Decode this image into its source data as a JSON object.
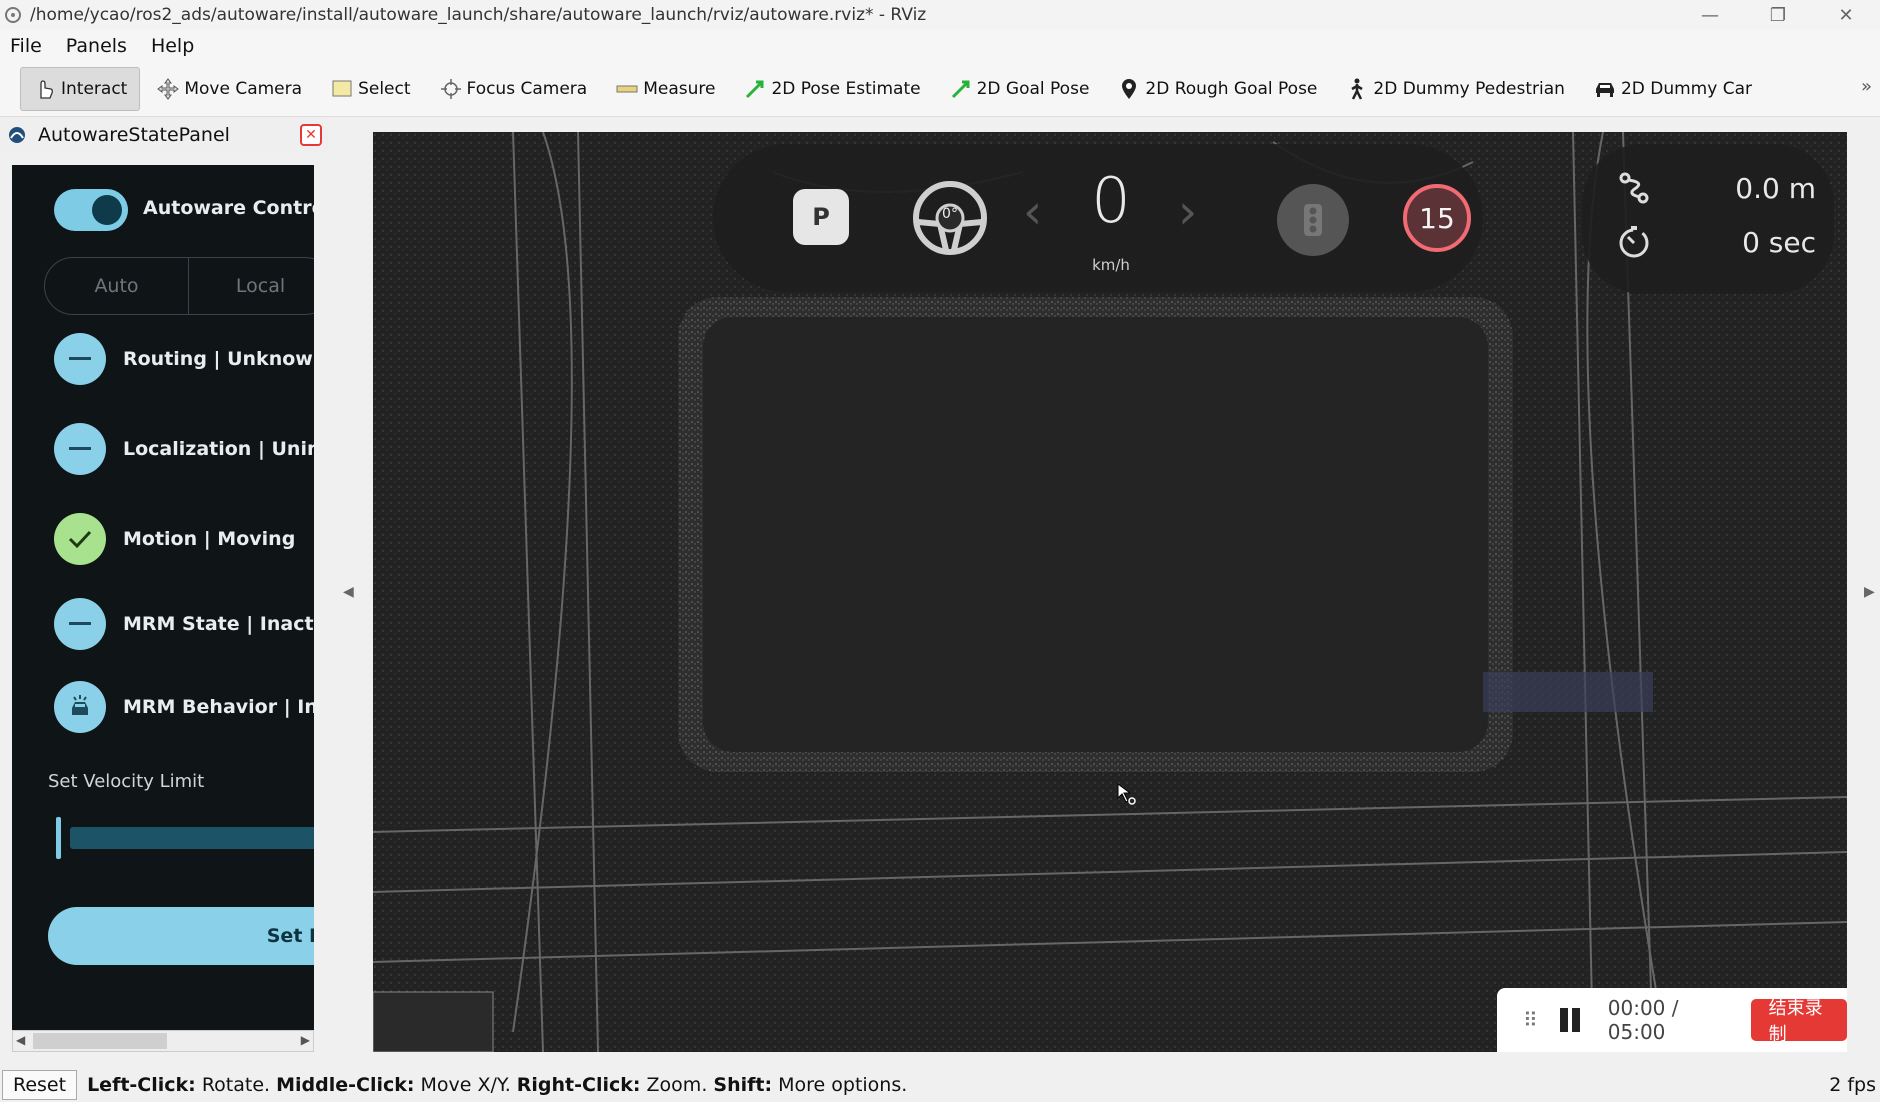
{
  "window": {
    "title": "/home/ycao/ros2_ads/autoware/install/autoware_launch/share/autoware_launch/rviz/autoware.rviz* - RViz",
    "minimize": "—",
    "maximize": "❐",
    "close": "✕"
  },
  "menu": {
    "file": "File",
    "panels": "Panels",
    "help": "Help"
  },
  "toolbar": {
    "tools": [
      {
        "label": "Interact",
        "icon": "hand-pointer-icon",
        "active": true
      },
      {
        "label": "Move Camera",
        "icon": "move-camera-icon"
      },
      {
        "label": "Select",
        "icon": "select-icon"
      },
      {
        "label": "Focus Camera",
        "icon": "focus-camera-icon"
      },
      {
        "label": "Measure",
        "icon": "ruler-icon"
      },
      {
        "label": "2D Pose Estimate",
        "icon": "green-arrow-icon"
      },
      {
        "label": "2D Goal Pose",
        "icon": "green-arrow-icon"
      },
      {
        "label": "2D Rough Goal Pose",
        "icon": "map-pin-icon"
      },
      {
        "label": "2D Dummy Pedestrian",
        "icon": "pedestrian-icon"
      },
      {
        "label": "2D Dummy Car",
        "icon": "car-icon"
      }
    ],
    "more": "»"
  },
  "panel": {
    "title": "AutowareStatePanel",
    "control_label": "Autoware Contro",
    "control_on": true,
    "modes": [
      "Auto",
      "Local"
    ],
    "statuses": [
      {
        "label": "Routing | Unknown",
        "state": "unknown"
      },
      {
        "label": "Localization | Unini",
        "state": "unknown"
      },
      {
        "label": "Motion | Moving",
        "state": "ok"
      },
      {
        "label": "MRM State | Inactiv",
        "state": "unknown"
      },
      {
        "label": "MRM Behavior | Ina",
        "state": "vehicle"
      }
    ],
    "velocity_label": "Set Velocity Limit",
    "set_button": "Set E"
  },
  "hud": {
    "gear": "P",
    "steering": "0°",
    "speed": "0",
    "speed_unit": "km/h",
    "speed_limit": "15",
    "distance": "0.0 m",
    "time": "0 sec"
  },
  "recorder": {
    "time": "00:00 / 05:00",
    "stop_label": "结束录制"
  },
  "statusbar": {
    "reset": "Reset",
    "hint_parts": [
      {
        "b": "Left-Click:",
        "t": " Rotate. "
      },
      {
        "b": "Middle-Click:",
        "t": " Move X/Y. "
      },
      {
        "b": "Right-Click:",
        "t": " Zoom. "
      },
      {
        "b": "Shift:",
        "t": " More options."
      }
    ],
    "fps": "2 fps"
  },
  "colors": {
    "accent": "#8ad0e9",
    "ok": "#a8e28e",
    "limit_ring": "#f06b73",
    "stop_button": "#e53935"
  }
}
